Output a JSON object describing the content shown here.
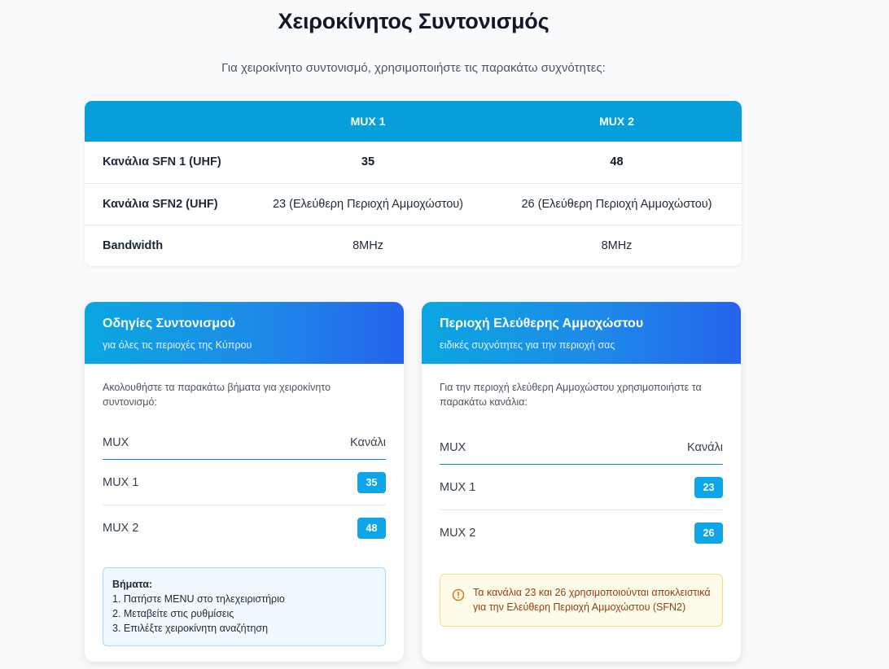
{
  "page": {
    "title": "Χειροκίνητος Συντονισμός",
    "subtitle": "Για χειροκίνητο συντονισμό, χρησιμοποιήστε τις παρακάτω συχνότητες:"
  },
  "freq_table": {
    "headers": [
      "",
      "MUX 1",
      "MUX 2"
    ],
    "rows": [
      {
        "label": "Κανάλια SFN 1 (UHF)",
        "mux1": "35",
        "mux2": "48"
      },
      {
        "label": "Κανάλια SFN2 (UHF)",
        "mux1": "23 (Ελεύθερη Περιοχή Αμμοχώστου)",
        "mux2": "26 (Ελεύθερη Περιοχή Αμμοχώστου)"
      },
      {
        "label": "Bandwidth",
        "mux1": "8MHz",
        "mux2": "8MHz"
      }
    ]
  },
  "card_instructions": {
    "title": "Οδηγίες Συντονισμού",
    "subtitle": "για όλες τις περιοχές της Κύπρου",
    "intro": "Ακολουθήστε τα παρακάτω βήματα για χειροκίνητο συντονισμό:",
    "col_mux": "MUX",
    "col_channel": "Κανάλι",
    "rows": [
      {
        "mux": "MUX 1",
        "channel": "35"
      },
      {
        "mux": "MUX 2",
        "channel": "48"
      }
    ],
    "steps_title": "Βήματα:",
    "steps": [
      "1. Πατήστε MENU στο τηλεχειριστήριο",
      "2. Μεταβείτε στις ρυθμίσεις",
      "3. Επιλέξτε χειροκίνητη αναζήτηση"
    ]
  },
  "card_famagusta": {
    "title": "Περιοχή Ελεύθερης Αμμοχώστου",
    "subtitle": "ειδικές συχνότητες για την περιοχή σας",
    "intro": "Για την περιοχή ελεύθερη Αμμοχώστου χρησιμοποιήστε τα παρακάτω κανάλια:",
    "col_mux": "MUX",
    "col_channel": "Κανάλι",
    "rows": [
      {
        "mux": "MUX 1",
        "channel": "23"
      },
      {
        "mux": "MUX 2",
        "channel": "26"
      }
    ],
    "warning_icon": "info-circle-icon",
    "warning": "Τα κανάλια 23 και 26 χρησιμοποιούνται αποκλειστικά για την Ελεύθερη Περιοχή Αμμοχώστου (SFN2)"
  },
  "colors": {
    "table_header": "#069fdc",
    "card_header_start": "#0aa6e0",
    "card_header_end": "#2563eb",
    "badge": "#0ea5e9",
    "warning_bg": "#fffbeb",
    "warning_border": "#fcd97a",
    "warning_text": "#92400e",
    "steps_bg": "#f0f9ff",
    "steps_border": "#a5d8f3"
  }
}
